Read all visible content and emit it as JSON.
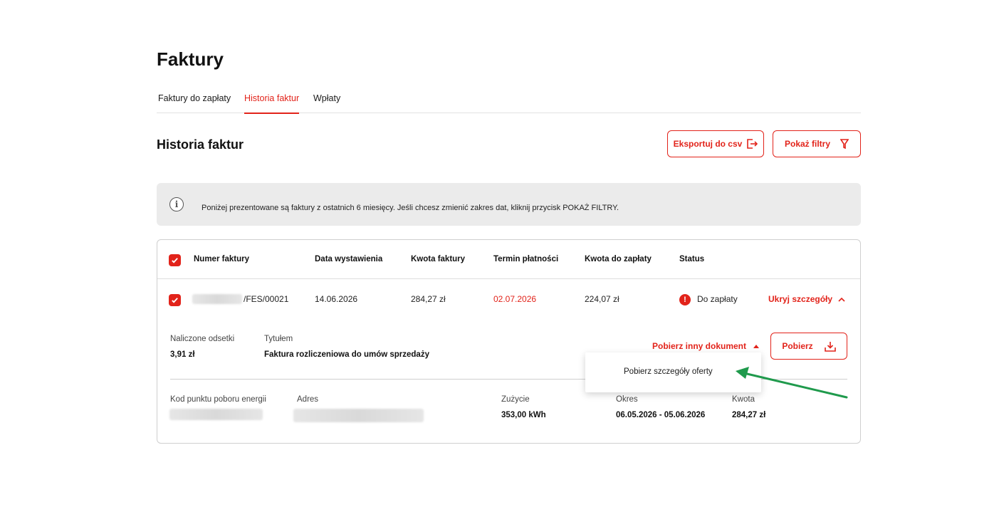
{
  "page": {
    "title": "Faktury"
  },
  "tabs": [
    {
      "label": "Faktury do zapłaty",
      "active": false
    },
    {
      "label": "Historia faktur",
      "active": true
    },
    {
      "label": "Wpłaty",
      "active": false
    }
  ],
  "section": {
    "title": "Historia faktur",
    "export_label": "Eksportuj do csv",
    "filters_label": "Pokaż filtry"
  },
  "info": {
    "text": "Poniżej prezentowane są faktury z ostatnich 6 miesięcy. Jeśli chcesz zmienić zakres dat, kliknij przycisk POKAŻ FILTRY."
  },
  "table": {
    "headers": {
      "number": "Numer faktury",
      "issue_date": "Data wystawienia",
      "amount": "Kwota faktury",
      "due_date": "Termin płatności",
      "to_pay": "Kwota do zapłaty",
      "status": "Status"
    },
    "row": {
      "number_suffix": "/FES/00021",
      "issue_date": "14.06.2026",
      "amount": "284,27 zł",
      "due_date": "02.07.2026",
      "to_pay": "224,07 zł",
      "status": "Do zapłaty",
      "toggle_label": "Ukryj szczegóły"
    },
    "details": {
      "interest_label": "Naliczone odsetki",
      "interest_value": "3,91 zł",
      "title_label": "Tytułem",
      "title_value": "Faktura rozliczeniowa do umów sprzedaży",
      "other_doc_label": "Pobierz inny dokument",
      "download_label": "Pobierz",
      "dropdown_items": [
        "Pobierz szczegóły oferty"
      ],
      "ppe_label": "Kod punktu poboru energii",
      "address_label": "Adres",
      "usage_label": "Zużycie",
      "usage_value": "353,00 kWh",
      "period_label": "Okres",
      "period_value": "06.05.2026 - 05.06.2026",
      "amount_label": "Kwota",
      "amount_value": "284,27 zł"
    }
  },
  "colors": {
    "accent": "#e2231a",
    "annotation_arrow": "#1f9a4c"
  }
}
